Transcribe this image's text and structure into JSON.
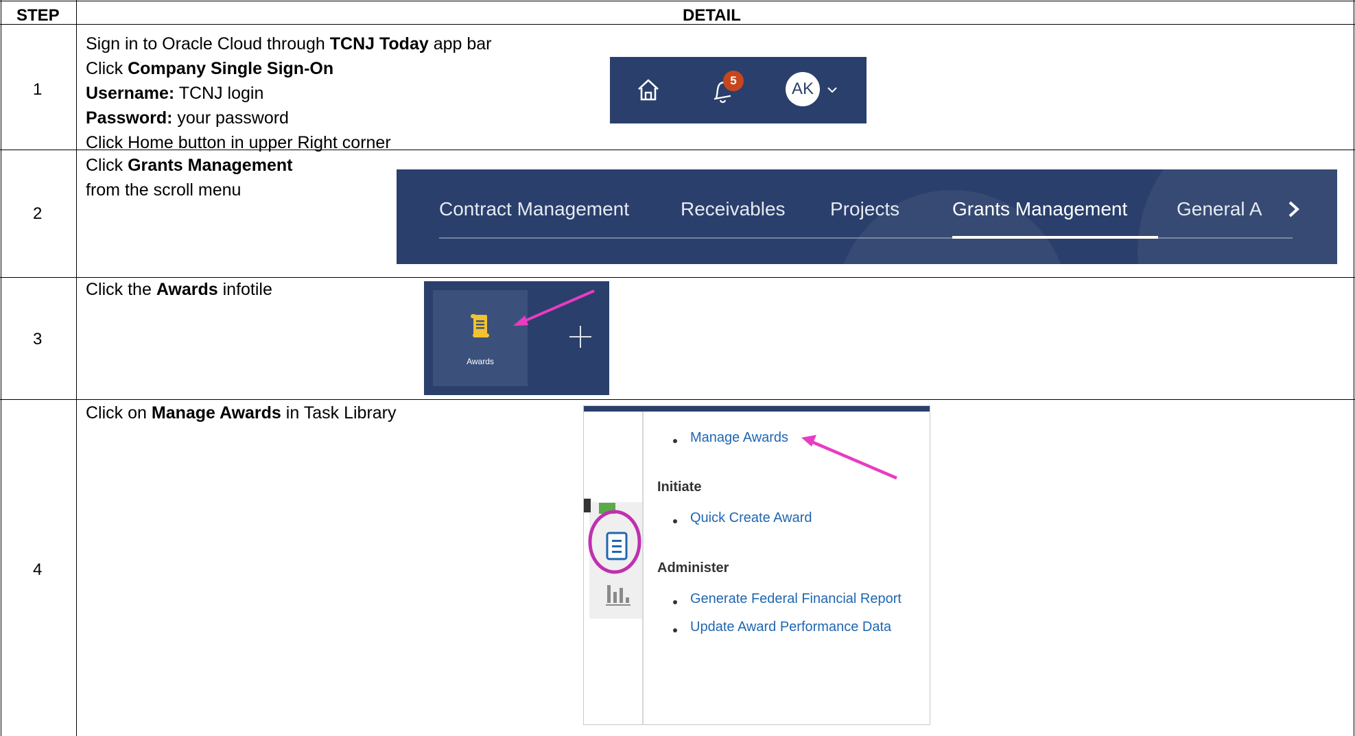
{
  "table": {
    "header": {
      "step": "STEP",
      "detail": "DETAIL"
    },
    "rows": [
      {
        "number": "1",
        "lines": [
          {
            "pre": "Sign in to Oracle Cloud through ",
            "bold": "TCNJ Today",
            "post": " app bar"
          },
          {
            "pre": "Click ",
            "bold": "Company Single Sign-On",
            "post": ""
          },
          {
            "pre": "",
            "bold": "Username:",
            "post": " TCNJ login"
          },
          {
            "pre": "",
            "bold": "Password:",
            "post": " your password"
          },
          {
            "pre": "Click Home button in upper Right corner",
            "bold": "",
            "post": ""
          }
        ]
      },
      {
        "number": "2",
        "lines": [
          {
            "pre": "Click ",
            "bold": "Grants Management",
            "post": ""
          },
          {
            "pre": "from the scroll menu",
            "bold": "",
            "post": ""
          }
        ]
      },
      {
        "number": "3",
        "lines": [
          {
            "pre": "Click the ",
            "bold": "Awards",
            "post": " infotile"
          }
        ]
      },
      {
        "number": "4",
        "lines": [
          {
            "pre": "Click on ",
            "bold": "Manage Awards",
            "post": " in Task Library"
          }
        ]
      }
    ]
  },
  "appbar": {
    "notification_count": "5",
    "avatar_initials": "AK",
    "icons": [
      "home-icon",
      "bell-icon",
      "chevron-down-icon"
    ]
  },
  "navbar": {
    "items": [
      "Contract Management",
      "Receivables",
      "Projects",
      "Grants Management",
      "General Ac"
    ],
    "active_index": 3
  },
  "infotile": {
    "label": "Awards",
    "icons": [
      "scroll-icon",
      "plus-icon"
    ]
  },
  "task_library": {
    "manage_awards": "Manage Awards",
    "initiate_heading": "Initiate",
    "quick_create": "Quick Create Award",
    "administer_heading": "Administer",
    "generate_report": "Generate Federal Financial Report",
    "update_performance": "Update Award Performance Data",
    "icons": [
      "task-list-icon",
      "bar-chart-icon"
    ]
  },
  "colors": {
    "oracle_navy": "#2a3f6b",
    "badge": "#c8461e",
    "link": "#1f66b0",
    "annotation": "#e83cc2"
  }
}
